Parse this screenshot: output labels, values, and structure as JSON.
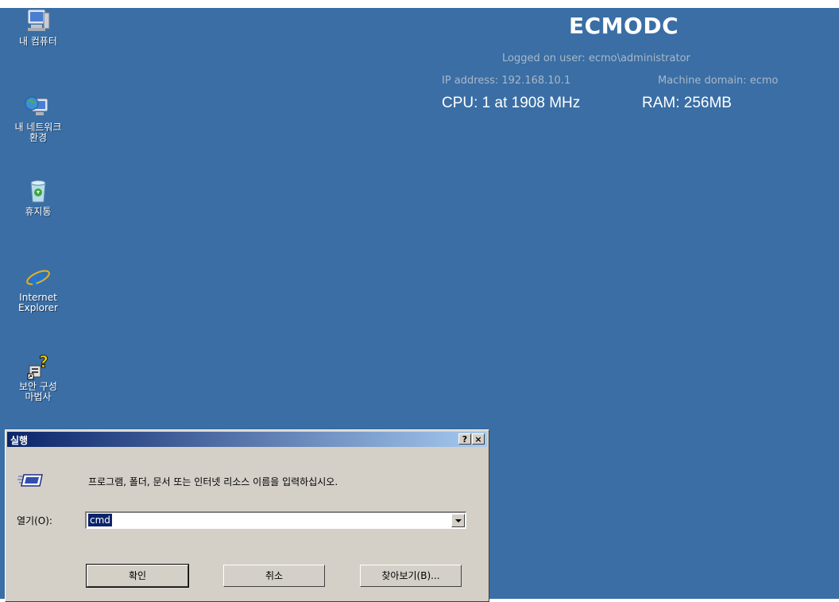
{
  "desktop": {
    "background_color": "#3a6ea5",
    "icons": [
      {
        "name": "my-computer",
        "label": "내 컴퓨터"
      },
      {
        "name": "network-places",
        "label": "내 네트워크\n환경"
      },
      {
        "name": "recycle-bin",
        "label": "휴지통"
      },
      {
        "name": "internet-explorer",
        "label": "Internet\nExplorer"
      },
      {
        "name": "security-wizard",
        "label": "보안 구성\n마법사"
      }
    ]
  },
  "bginfo": {
    "hostname": "ECMODC",
    "logged_on": "Logged on user: ecmo\\administrator",
    "ip": "IP address: 192.168.10.1",
    "domain": "Machine domain: ecmo",
    "cpu": "CPU: 1 at 1908 MHz",
    "ram": "RAM: 256MB"
  },
  "run_dialog": {
    "title": "실행",
    "help_button": "?",
    "close_button": "×",
    "prompt": "프로그램, 폴더, 문서 또는 인터넷 리소스 이름을 입력하십시오.",
    "open_label": "열기(O):",
    "open_value": "cmd",
    "ok_label": "확인",
    "cancel_label": "취소",
    "browse_label": "찾아보기(B)..."
  }
}
